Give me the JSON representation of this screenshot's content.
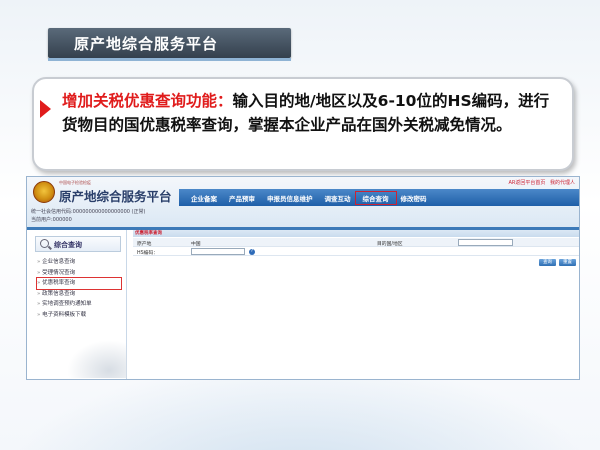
{
  "slide": {
    "title": "原产地综合服务平台",
    "callout_highlight": "增加关税优惠查询功能：",
    "callout_body": "输入目的地/地区以及6-10位的HS编码，进行货物目的国优惠税率查询，掌握本企业产品在国外关税减免情况。"
  },
  "screenshot": {
    "logo_small": "中国电子检验检疫",
    "logo_title": "原产地综合服务平台",
    "user_line1": "统一社会信用代码:000000000000000000 (正常)",
    "user_line2": "当前用户:000000",
    "top_links": [
      "AR返回平台首页",
      "我的代理人"
    ],
    "nav": [
      "企业备案",
      "产品预审",
      "申报员信息维护",
      "调查互动",
      "综合查询",
      "修改密码"
    ],
    "nav_active": "综合查询",
    "sidebar": {
      "header": "综合查询",
      "items": [
        "企业信息查询",
        "受理情况查询",
        "优惠税率查询",
        "政策信息查询",
        "实地调查预约通知单",
        "电子资料模板下载"
      ],
      "active": "优惠税率查询"
    },
    "panel": {
      "tab_label": "优惠税率查询",
      "origin_label": "原产地",
      "origin_value": "中国",
      "dest_label": "目的国/地区",
      "hs_label": "HS编码：",
      "help_glyph": "?",
      "query_button": "查询",
      "reset_button": "重置"
    }
  },
  "colors": {
    "accent_red": "#e01c1c",
    "nav_blue": "#1f5fa8",
    "title_bar": "#34404d"
  }
}
